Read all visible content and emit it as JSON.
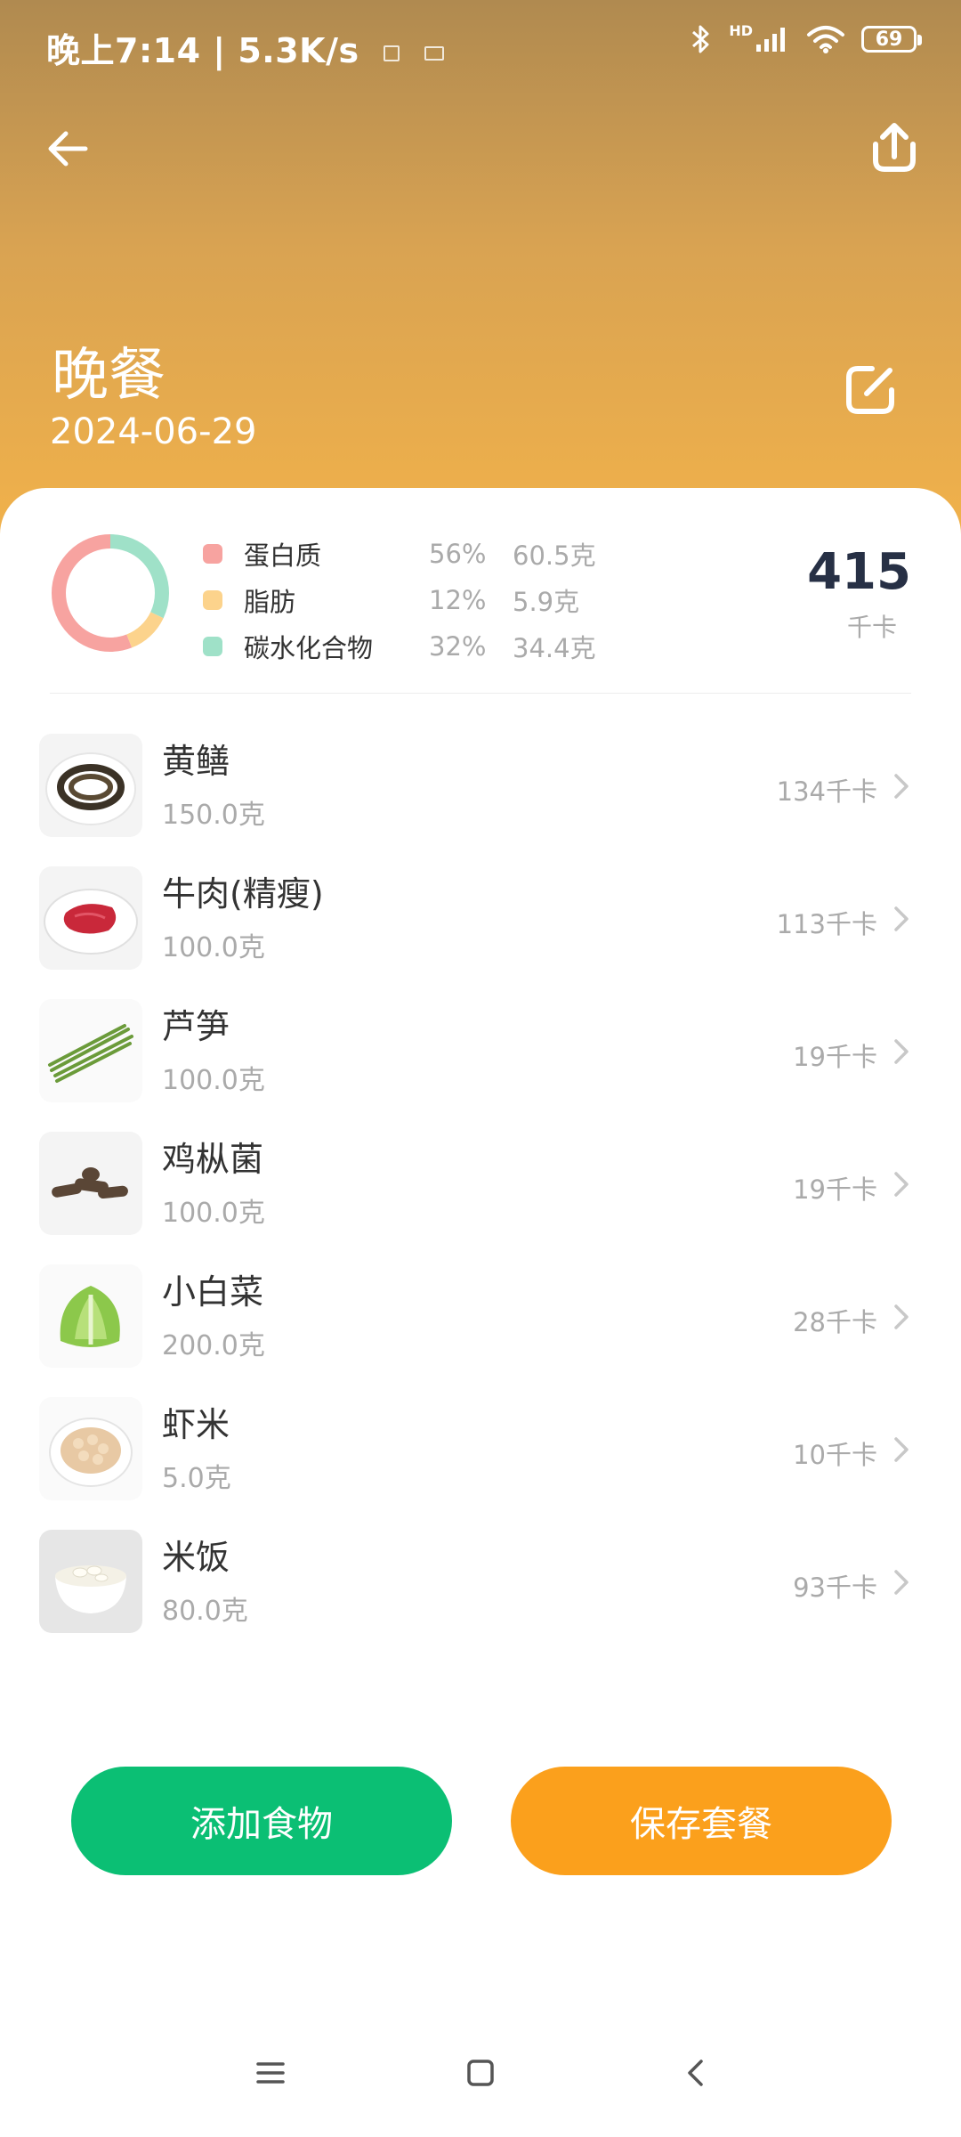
{
  "status_bar": {
    "time_speed": "晚上7:14 | 5.3K/s",
    "battery": "69",
    "network_badge": "HD",
    "icons": [
      "sim-icon",
      "mail-icon",
      "bluetooth-icon",
      "signal-icon",
      "wifi-icon",
      "battery-icon"
    ]
  },
  "nav": {
    "back_icon": "arrow-left-icon",
    "share_icon": "share-upload-icon"
  },
  "meal": {
    "title": "晚餐",
    "date": "2024-06-29",
    "edit_icon": "edit-icon"
  },
  "nutrition": {
    "total_kcal": "415",
    "total_unit": "千卡",
    "macros": [
      {
        "name": "蛋白质",
        "pct": "56%",
        "grams": "60.5克",
        "color": "#f7a3a0",
        "share": 0.56
      },
      {
        "name": "脂肪",
        "pct": "12%",
        "grams": "5.9克",
        "color": "#fcd38c",
        "share": 0.12
      },
      {
        "name": "碳水化合物",
        "pct": "32%",
        "grams": "34.4克",
        "color": "#9fe1c8",
        "share": 0.32
      }
    ]
  },
  "foods": [
    {
      "name": "黄鳝",
      "amount": "150.0克",
      "kcal": "134千卡",
      "image": "eel"
    },
    {
      "name": "牛肉(精瘦)",
      "amount": "100.0克",
      "kcal": "113千卡",
      "image": "beef"
    },
    {
      "name": "芦笋",
      "amount": "100.0克",
      "kcal": "19千卡",
      "image": "asparagus"
    },
    {
      "name": "鸡枞菌",
      "amount": "100.0克",
      "kcal": "19千卡",
      "image": "mushroom"
    },
    {
      "name": "小白菜",
      "amount": "200.0克",
      "kcal": "28千卡",
      "image": "bok-choy"
    },
    {
      "name": "虾米",
      "amount": "5.0克",
      "kcal": "10千卡",
      "image": "dried-shrimp"
    },
    {
      "name": "米饭",
      "amount": "80.0克",
      "kcal": "93千卡",
      "image": "rice"
    }
  ],
  "actions": {
    "add_food": "添加食物",
    "save_meal": "保存套餐"
  },
  "colors": {
    "header_gradient": [
      "#b08a50",
      "#f2b24a"
    ],
    "add_button": "#0bbf74",
    "save_button": "#fba01c"
  },
  "system_nav": [
    "menu-icon",
    "home-square-icon",
    "back-chevron-icon"
  ]
}
